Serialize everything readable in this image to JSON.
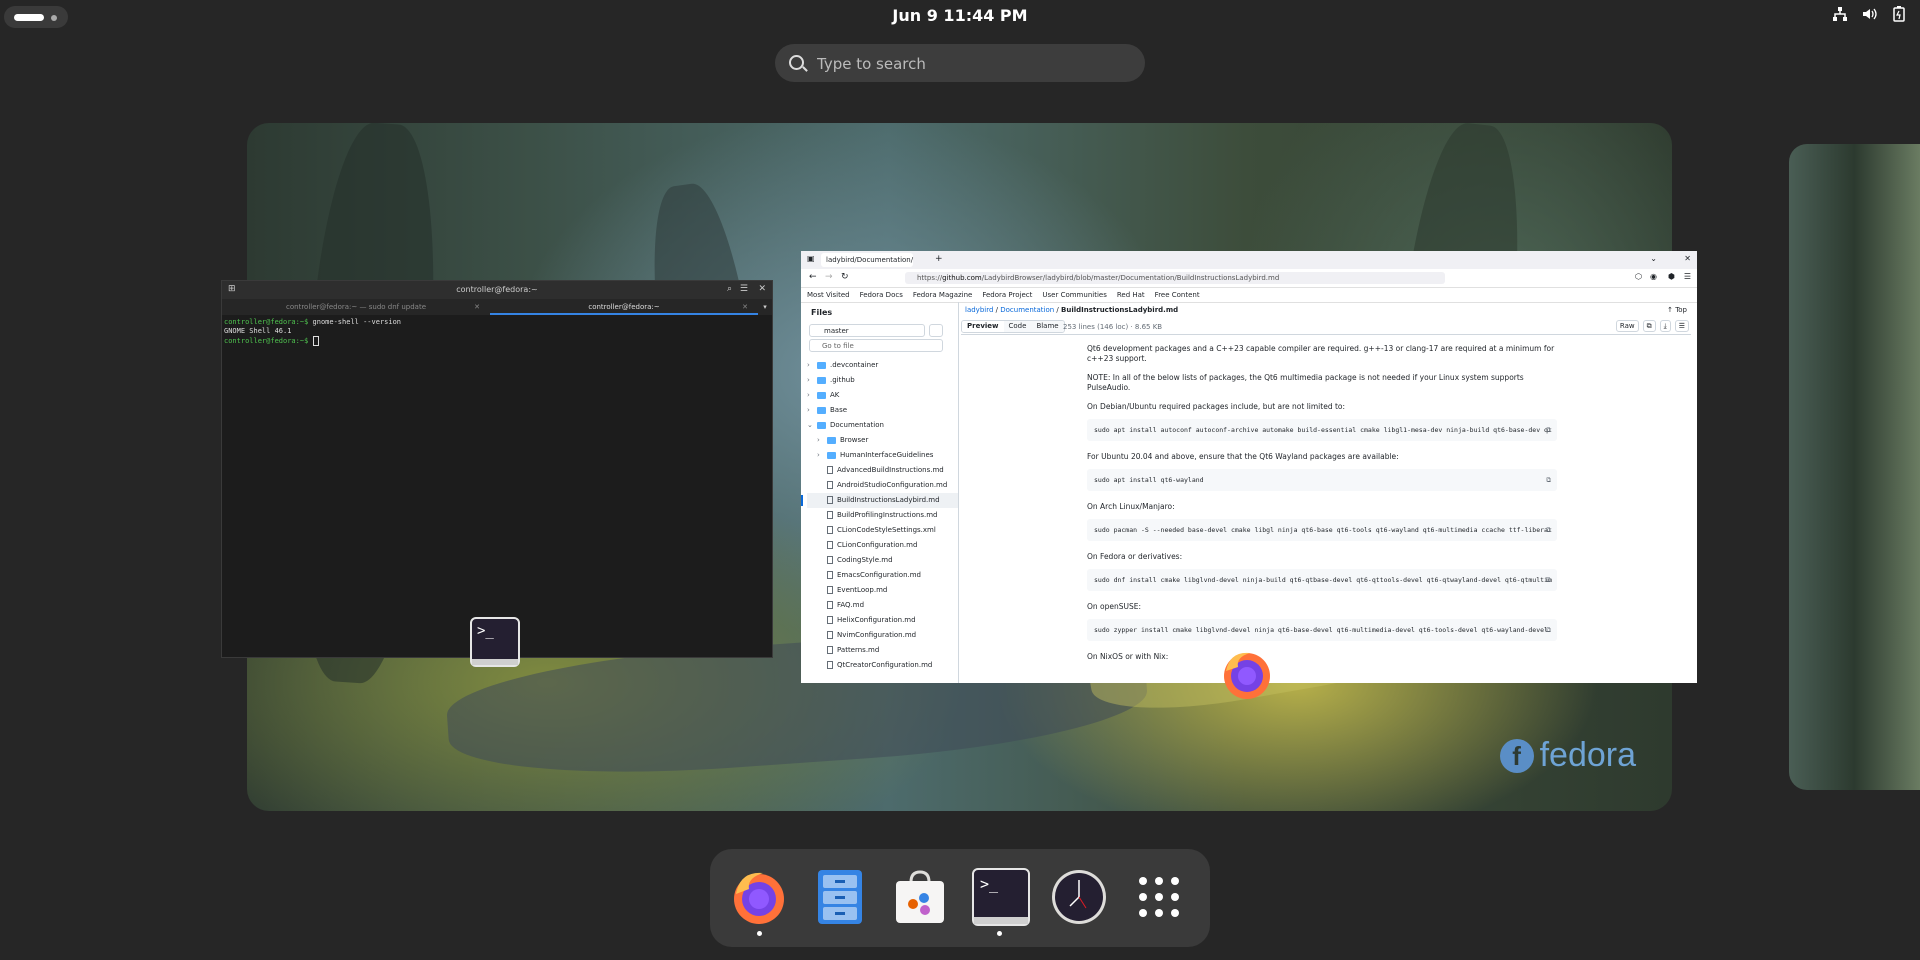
{
  "topbar": {
    "clock": "Jun 9  11:44 PM",
    "tray_icons": [
      "network-icon",
      "volume-icon",
      "battery-icon"
    ]
  },
  "search": {
    "placeholder": "Type to search"
  },
  "wallpaper": {
    "brand": "fedora"
  },
  "terminal": {
    "title": "controller@fedora:~",
    "tabs": [
      {
        "label": "controller@fedora:~ — sudo dnf update",
        "active": false
      },
      {
        "label": "controller@fedora:~",
        "active": true
      }
    ],
    "lines": [
      {
        "prompt": "controller@fedora:~$",
        "text": " gnome-shell --version"
      },
      {
        "prompt": "",
        "text": "GNOME Shell 46.1"
      },
      {
        "prompt": "controller@fedora:~$",
        "text": " "
      }
    ]
  },
  "browser": {
    "tab_title": "ladybird/Documentation/",
    "url_prefix": "https://",
    "url_domain": "github.com",
    "url_path": "/LadybirdBrowser/ladybird/blob/master/Documentation/BuildInstructionsLadybird.md",
    "bookmarks": [
      "Most Visited",
      "Fedora Docs",
      "Fedora Magazine",
      "Fedora Project",
      "User Communities",
      "Red Hat",
      "Free Content"
    ],
    "sidebar": {
      "title": "Files",
      "branch": "master",
      "goto_placeholder": "Go to file",
      "tree": [
        {
          "name": ".devcontainer",
          "type": "folder",
          "depth": 0
        },
        {
          "name": ".github",
          "type": "folder",
          "depth": 0
        },
        {
          "name": "AK",
          "type": "folder",
          "depth": 0
        },
        {
          "name": "Base",
          "type": "folder",
          "depth": 0
        },
        {
          "name": "Documentation",
          "type": "folder",
          "depth": 0
        },
        {
          "name": "Browser",
          "type": "folder",
          "depth": 1
        },
        {
          "name": "HumanInterfaceGuidelines",
          "type": "folder",
          "depth": 1
        },
        {
          "name": "AdvancedBuildInstructions.md",
          "type": "file",
          "depth": 1
        },
        {
          "name": "AndroidStudioConfiguration.md",
          "type": "file",
          "depth": 1
        },
        {
          "name": "BuildInstructionsLadybird.md",
          "type": "file",
          "depth": 1,
          "selected": true
        },
        {
          "name": "BuildProfilingInstructions.md",
          "type": "file",
          "depth": 1
        },
        {
          "name": "CLionCodeStyleSettings.xml",
          "type": "file",
          "depth": 1
        },
        {
          "name": "CLionConfiguration.md",
          "type": "file",
          "depth": 1
        },
        {
          "name": "CodingStyle.md",
          "type": "file",
          "depth": 1
        },
        {
          "name": "EmacsConfiguration.md",
          "type": "file",
          "depth": 1
        },
        {
          "name": "EventLoop.md",
          "type": "file",
          "depth": 1
        },
        {
          "name": "FAQ.md",
          "type": "file",
          "depth": 1
        },
        {
          "name": "HelixConfiguration.md",
          "type": "file",
          "depth": 1
        },
        {
          "name": "NvimConfiguration.md",
          "type": "file",
          "depth": 1
        },
        {
          "name": "Patterns.md",
          "type": "file",
          "depth": 1
        },
        {
          "name": "QtCreatorConfiguration.md",
          "type": "file",
          "depth": 1
        }
      ]
    },
    "breadcrumbs": {
      "repo": "ladybird",
      "folder": "Documentation",
      "file": "BuildInstructionsLadybird.md"
    },
    "top_link": "Top",
    "view_tabs": [
      "Preview",
      "Code",
      "Blame"
    ],
    "file_meta": "253 lines (146 loc) · 8.65 KB",
    "raw_label": "Raw",
    "doc": [
      {
        "type": "p",
        "text": "Qt6 development packages and a C++23 capable compiler are required. g++-13 or clang-17 are required at a minimum for c++23 support."
      },
      {
        "type": "p",
        "text": "NOTE: In all of the below lists of packages, the Qt6 multimedia package is not needed if your Linux system supports PulseAudio."
      },
      {
        "type": "p",
        "text": "On Debian/Ubuntu required packages include, but are not limited to:"
      },
      {
        "type": "code",
        "text": "sudo apt install autoconf autoconf-archive automake build-essential cmake libgl1-mesa-dev ninja-build qt6-base-dev qt"
      },
      {
        "type": "p",
        "text": "For Ubuntu 20.04 and above, ensure that the Qt6 Wayland packages are available:"
      },
      {
        "type": "code",
        "text": "sudo apt install qt6-wayland"
      },
      {
        "type": "p",
        "text": "On Arch Linux/Manjaro:"
      },
      {
        "type": "code",
        "text": "sudo pacman -S --needed base-devel cmake libgl ninja qt6-base qt6-tools qt6-wayland qt6-multimedia ccache ttf-liberat"
      },
      {
        "type": "p",
        "text": "On Fedora or derivatives:"
      },
      {
        "type": "code",
        "text": "sudo dnf install cmake libglvnd-devel ninja-build qt6-qtbase-devel qt6-qttools-devel qt6-qtwayland-devel qt6-qtmultim"
      },
      {
        "type": "p",
        "text": "On openSUSE:"
      },
      {
        "type": "code",
        "text": "sudo zypper install cmake libglvnd-devel ninja qt6-base-devel qt6-multimedia-devel qt6-tools-devel qt6-wayland-devel"
      },
      {
        "type": "p",
        "text": "On NixOS or with Nix:"
      }
    ]
  },
  "dash": {
    "apps": [
      {
        "name": "Firefox",
        "icon": "firefox-icon",
        "running": true
      },
      {
        "name": "Files",
        "icon": "files-icon",
        "running": false
      },
      {
        "name": "Software",
        "icon": "software-icon",
        "running": false
      },
      {
        "name": "Terminal",
        "icon": "terminal-icon",
        "running": true
      },
      {
        "name": "Clocks",
        "icon": "clock-icon",
        "running": false
      },
      {
        "name": "Show Apps",
        "icon": "app-grid-icon",
        "running": false
      }
    ],
    "terminal_glyph": ">_"
  }
}
